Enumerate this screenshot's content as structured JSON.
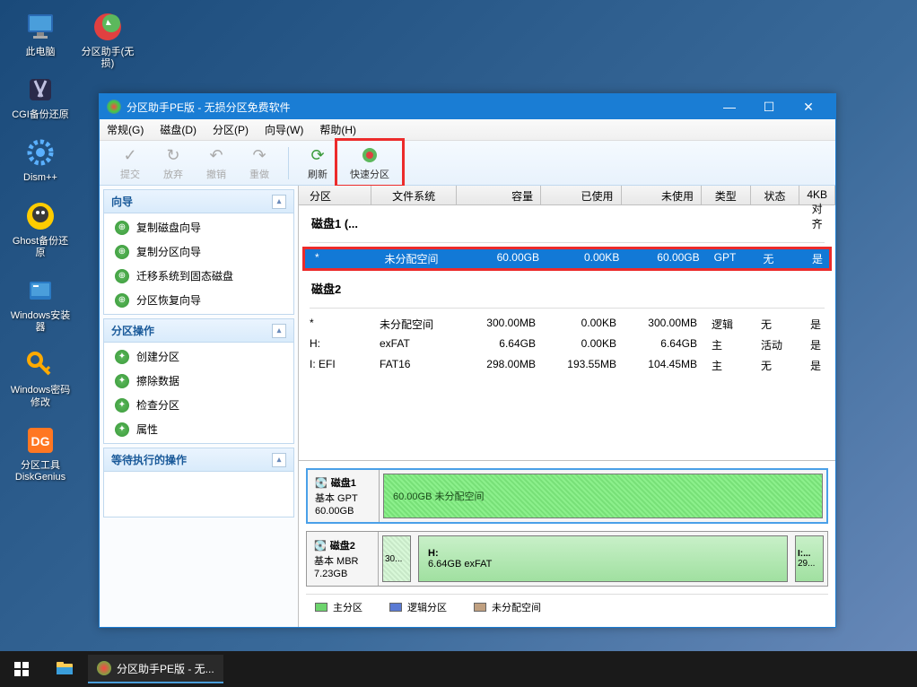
{
  "desktop": {
    "icons": [
      {
        "label": "此电脑",
        "color": "#4a9edb"
      },
      {
        "label": "CGI备份还原",
        "color": "#d4a050"
      },
      {
        "label": "Dism++",
        "color": "#4a9edb"
      },
      {
        "label": "Ghost备份还原",
        "color": "#ffcc00"
      },
      {
        "label": "Windows安装器",
        "color": "#4a9edb"
      },
      {
        "label": "Windows密码修改",
        "color": "#ffaa00"
      },
      {
        "label": "分区工具DiskGenius",
        "color": "#ff7722"
      }
    ],
    "icon2": {
      "label": "分区助手(无损)",
      "color": "#5cb85c"
    }
  },
  "window": {
    "title": "分区助手PE版 - 无损分区免费软件",
    "menu": [
      "常规(G)",
      "磁盘(D)",
      "分区(P)",
      "向导(W)",
      "帮助(H)"
    ],
    "toolbar": [
      {
        "label": "提交",
        "icon": "✓"
      },
      {
        "label": "放弃",
        "icon": "↻"
      },
      {
        "label": "撤销",
        "icon": "↶"
      },
      {
        "label": "重做",
        "icon": "↷"
      },
      {
        "label": "刷新",
        "icon": "⟳"
      },
      {
        "label": "快速分区",
        "icon": "◉"
      }
    ],
    "sidebar": {
      "wizard": {
        "title": "向导",
        "items": [
          "复制磁盘向导",
          "复制分区向导",
          "迁移系统到固态磁盘",
          "分区恢复向导"
        ]
      },
      "ops": {
        "title": "分区操作",
        "items": [
          "创建分区",
          "擦除数据",
          "检查分区",
          "属性"
        ]
      },
      "pending": {
        "title": "等待执行的操作"
      }
    },
    "columns": [
      "分区",
      "文件系统",
      "容量",
      "已使用",
      "未使用",
      "类型",
      "状态",
      "4KB对齐"
    ],
    "disk1": {
      "label": "磁盘1 (...",
      "row": {
        "part": "*",
        "fs": "未分配空间",
        "cap": "60.00GB",
        "used": "0.00KB",
        "free": "60.00GB",
        "type": "GPT",
        "status": "无",
        "align": "是"
      }
    },
    "disk2": {
      "label": "磁盘2",
      "rows": [
        {
          "part": "*",
          "fs": "未分配空间",
          "cap": "300.00MB",
          "used": "0.00KB",
          "free": "300.00MB",
          "type": "逻辑",
          "status": "无",
          "align": "是"
        },
        {
          "part": "H:",
          "fs": "exFAT",
          "cap": "6.64GB",
          "used": "0.00KB",
          "free": "6.64GB",
          "type": "主",
          "status": "活动",
          "align": "是"
        },
        {
          "part": "I: EFI",
          "fs": "FAT16",
          "cap": "298.00MB",
          "used": "193.55MB",
          "free": "104.45MB",
          "type": "主",
          "status": "无",
          "align": "是"
        }
      ]
    },
    "diskvis": {
      "d1": {
        "name": "磁盘1",
        "type": "基本 GPT",
        "size": "60.00GB",
        "part_label": "60.00GB 未分配空间"
      },
      "d2": {
        "name": "磁盘2",
        "type": "基本 MBR",
        "size": "7.23GB",
        "p1": "30...",
        "p2a": "H:",
        "p2b": "6.64GB exFAT",
        "p3a": "I:...",
        "p3b": "29..."
      }
    },
    "legend": {
      "primary": "主分区",
      "logical": "逻辑分区",
      "unalloc": "未分配空间"
    }
  },
  "taskbar": {
    "app": "分区助手PE版 - 无..."
  }
}
